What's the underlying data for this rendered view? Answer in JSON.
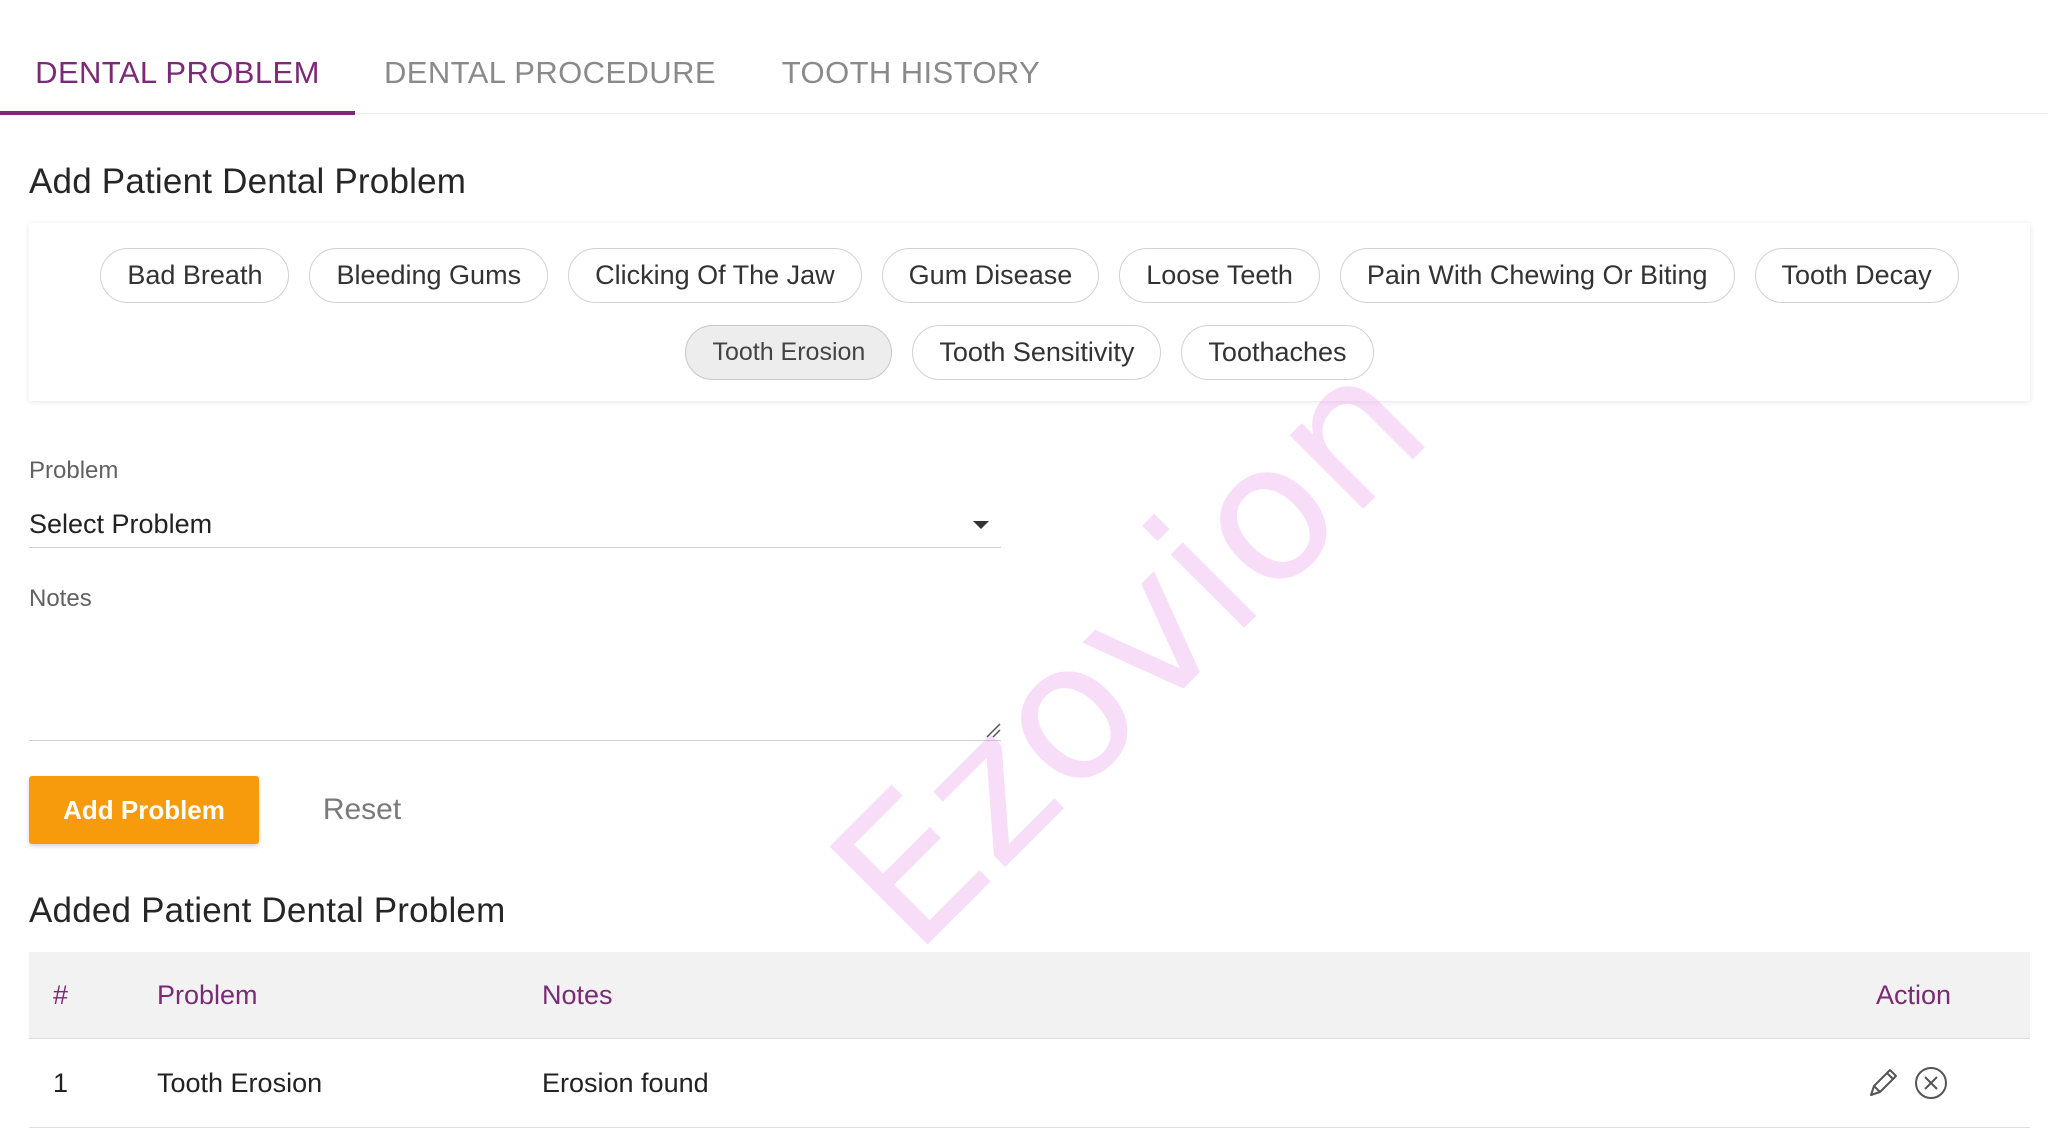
{
  "tabs": [
    {
      "label": "DENTAL PROBLEM",
      "active": true
    },
    {
      "label": "DENTAL PROCEDURE",
      "active": false
    },
    {
      "label": "TOOTH HISTORY",
      "active": false
    }
  ],
  "add_section": {
    "title": "Add Patient Dental Problem",
    "chips_row1": [
      "Bad Breath",
      "Bleeding Gums",
      "Clicking Of The Jaw",
      "Gum Disease",
      "Loose Teeth",
      "Pain With Chewing Or Biting",
      "Tooth Decay"
    ],
    "chips_row2": [
      "Tooth Erosion",
      "Tooth Sensitivity",
      "Toothaches"
    ],
    "selected_chip": "Tooth Erosion"
  },
  "form": {
    "problem_label": "Problem",
    "problem_value": "Select Problem",
    "notes_label": "Notes",
    "notes_value": "",
    "add_button": "Add Problem",
    "reset_button": "Reset"
  },
  "added_section": {
    "title": "Added Patient Dental Problem",
    "headers": {
      "num": "#",
      "problem": "Problem",
      "notes": "Notes",
      "action": "Action"
    },
    "rows": [
      {
        "num": "1",
        "problem": "Tooth Erosion",
        "notes": "Erosion found"
      }
    ]
  },
  "watermark": "Ezovion",
  "colors": {
    "accent": "#7b2a76",
    "button": "#f79a0b"
  },
  "icons": {
    "edit": "pencil-icon",
    "delete": "close-circle-icon",
    "dropdown": "caret-down-icon"
  }
}
